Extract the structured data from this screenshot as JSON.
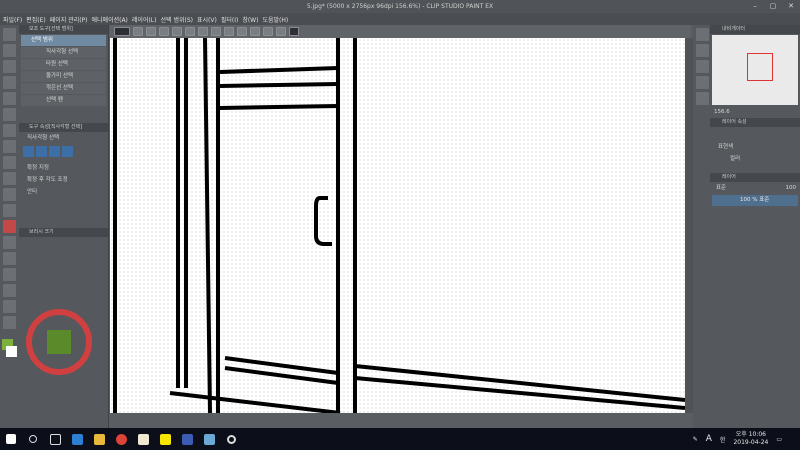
{
  "window": {
    "title": "5.jpg* (5000 x 2756px 96dpi 156.6%) - CLIP STUDIO PAINT EX",
    "controls": [
      "minimize-icon",
      "maximize-icon",
      "close-icon"
    ]
  },
  "menubar": [
    "파일(F)",
    "편집(E)",
    "페이지 관리(P)",
    "애니메이션(A)",
    "레이어(L)",
    "선택 범위(S)",
    "표시(V)",
    "필터(I)",
    "창(W)",
    "도움말(H)"
  ],
  "subtool_panel": {
    "header": "보조 도구[선택 범위]",
    "tabs": [
      "선택 범위"
    ],
    "items": [
      "직사각형 선택",
      "타원 선택",
      "올가미 선택",
      "꺾은선 선택",
      "선택 펜"
    ],
    "active_index": 0
  },
  "tool_property": {
    "header": "도구 속성[직사각형 선택]",
    "tool_name": "직사각형 선택",
    "rows": [
      "확정 지정",
      "확정 후 각도 조정",
      "안티"
    ]
  },
  "brush_size": {
    "header": "브러시 크기"
  },
  "right_panel": {
    "navigator_header": "내비게이터",
    "zoom": "156.6",
    "layer_property_header": "레이어 속성",
    "expression_label": "표현색",
    "color_label": "컬러",
    "layer_header": "레이어",
    "blend_mode": "표준",
    "opacity": "100",
    "layers": [
      {
        "name": "100 % 표준",
        "selected": true
      }
    ]
  },
  "taskbar": {
    "ime": "A",
    "lang": "한",
    "time": "오후 10:06",
    "date": "2019-04-24"
  },
  "colors": {
    "active_tool": "#c44848",
    "selection_blue": "#6f8aa1",
    "taskbar": "#0c0e1a"
  }
}
